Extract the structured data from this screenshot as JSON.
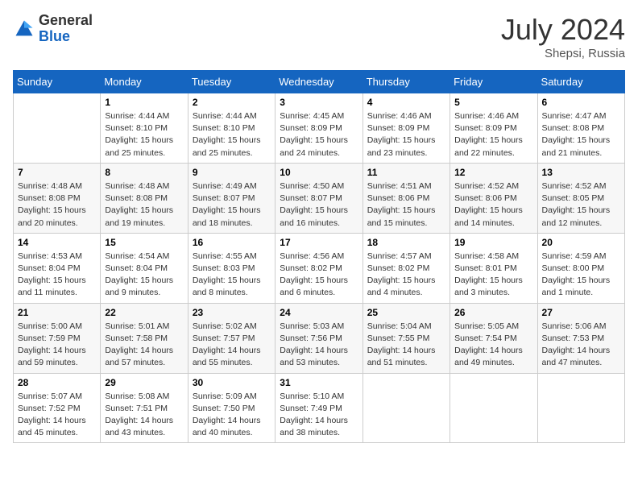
{
  "header": {
    "logo_general": "General",
    "logo_blue": "Blue",
    "month_year": "July 2024",
    "location": "Shepsi, Russia"
  },
  "days_of_week": [
    "Sunday",
    "Monday",
    "Tuesday",
    "Wednesday",
    "Thursday",
    "Friday",
    "Saturday"
  ],
  "weeks": [
    [
      {
        "day": "",
        "info": ""
      },
      {
        "day": "1",
        "info": "Sunrise: 4:44 AM\nSunset: 8:10 PM\nDaylight: 15 hours\nand 25 minutes."
      },
      {
        "day": "2",
        "info": "Sunrise: 4:44 AM\nSunset: 8:10 PM\nDaylight: 15 hours\nand 25 minutes."
      },
      {
        "day": "3",
        "info": "Sunrise: 4:45 AM\nSunset: 8:09 PM\nDaylight: 15 hours\nand 24 minutes."
      },
      {
        "day": "4",
        "info": "Sunrise: 4:46 AM\nSunset: 8:09 PM\nDaylight: 15 hours\nand 23 minutes."
      },
      {
        "day": "5",
        "info": "Sunrise: 4:46 AM\nSunset: 8:09 PM\nDaylight: 15 hours\nand 22 minutes."
      },
      {
        "day": "6",
        "info": "Sunrise: 4:47 AM\nSunset: 8:08 PM\nDaylight: 15 hours\nand 21 minutes."
      }
    ],
    [
      {
        "day": "7",
        "info": "Sunrise: 4:48 AM\nSunset: 8:08 PM\nDaylight: 15 hours\nand 20 minutes."
      },
      {
        "day": "8",
        "info": "Sunrise: 4:48 AM\nSunset: 8:08 PM\nDaylight: 15 hours\nand 19 minutes."
      },
      {
        "day": "9",
        "info": "Sunrise: 4:49 AM\nSunset: 8:07 PM\nDaylight: 15 hours\nand 18 minutes."
      },
      {
        "day": "10",
        "info": "Sunrise: 4:50 AM\nSunset: 8:07 PM\nDaylight: 15 hours\nand 16 minutes."
      },
      {
        "day": "11",
        "info": "Sunrise: 4:51 AM\nSunset: 8:06 PM\nDaylight: 15 hours\nand 15 minutes."
      },
      {
        "day": "12",
        "info": "Sunrise: 4:52 AM\nSunset: 8:06 PM\nDaylight: 15 hours\nand 14 minutes."
      },
      {
        "day": "13",
        "info": "Sunrise: 4:52 AM\nSunset: 8:05 PM\nDaylight: 15 hours\nand 12 minutes."
      }
    ],
    [
      {
        "day": "14",
        "info": "Sunrise: 4:53 AM\nSunset: 8:04 PM\nDaylight: 15 hours\nand 11 minutes."
      },
      {
        "day": "15",
        "info": "Sunrise: 4:54 AM\nSunset: 8:04 PM\nDaylight: 15 hours\nand 9 minutes."
      },
      {
        "day": "16",
        "info": "Sunrise: 4:55 AM\nSunset: 8:03 PM\nDaylight: 15 hours\nand 8 minutes."
      },
      {
        "day": "17",
        "info": "Sunrise: 4:56 AM\nSunset: 8:02 PM\nDaylight: 15 hours\nand 6 minutes."
      },
      {
        "day": "18",
        "info": "Sunrise: 4:57 AM\nSunset: 8:02 PM\nDaylight: 15 hours\nand 4 minutes."
      },
      {
        "day": "19",
        "info": "Sunrise: 4:58 AM\nSunset: 8:01 PM\nDaylight: 15 hours\nand 3 minutes."
      },
      {
        "day": "20",
        "info": "Sunrise: 4:59 AM\nSunset: 8:00 PM\nDaylight: 15 hours\nand 1 minute."
      }
    ],
    [
      {
        "day": "21",
        "info": "Sunrise: 5:00 AM\nSunset: 7:59 PM\nDaylight: 14 hours\nand 59 minutes."
      },
      {
        "day": "22",
        "info": "Sunrise: 5:01 AM\nSunset: 7:58 PM\nDaylight: 14 hours\nand 57 minutes."
      },
      {
        "day": "23",
        "info": "Sunrise: 5:02 AM\nSunset: 7:57 PM\nDaylight: 14 hours\nand 55 minutes."
      },
      {
        "day": "24",
        "info": "Sunrise: 5:03 AM\nSunset: 7:56 PM\nDaylight: 14 hours\nand 53 minutes."
      },
      {
        "day": "25",
        "info": "Sunrise: 5:04 AM\nSunset: 7:55 PM\nDaylight: 14 hours\nand 51 minutes."
      },
      {
        "day": "26",
        "info": "Sunrise: 5:05 AM\nSunset: 7:54 PM\nDaylight: 14 hours\nand 49 minutes."
      },
      {
        "day": "27",
        "info": "Sunrise: 5:06 AM\nSunset: 7:53 PM\nDaylight: 14 hours\nand 47 minutes."
      }
    ],
    [
      {
        "day": "28",
        "info": "Sunrise: 5:07 AM\nSunset: 7:52 PM\nDaylight: 14 hours\nand 45 minutes."
      },
      {
        "day": "29",
        "info": "Sunrise: 5:08 AM\nSunset: 7:51 PM\nDaylight: 14 hours\nand 43 minutes."
      },
      {
        "day": "30",
        "info": "Sunrise: 5:09 AM\nSunset: 7:50 PM\nDaylight: 14 hours\nand 40 minutes."
      },
      {
        "day": "31",
        "info": "Sunrise: 5:10 AM\nSunset: 7:49 PM\nDaylight: 14 hours\nand 38 minutes."
      },
      {
        "day": "",
        "info": ""
      },
      {
        "day": "",
        "info": ""
      },
      {
        "day": "",
        "info": ""
      }
    ]
  ]
}
